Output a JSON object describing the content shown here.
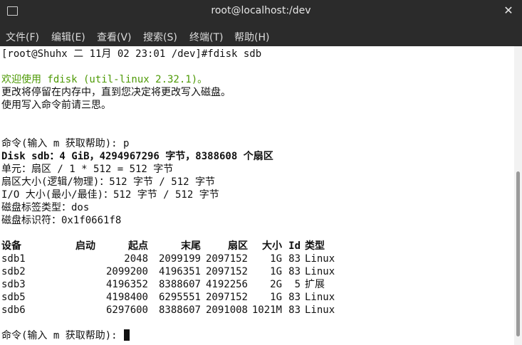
{
  "window": {
    "title": "root@localhost:/dev",
    "close_glyph": "✕",
    "icon_glyph": "⊡"
  },
  "menu": [
    "文件(F)",
    "编辑(E)",
    "查看(V)",
    "搜索(S)",
    "终端(T)",
    "帮助(H)"
  ],
  "terminal": {
    "prompt_line": "[root@Shuhx 二 11月 02 23:01 /dev]#fdisk sdb",
    "welcome": "欢迎使用 fdisk (util-linux 2.32.1)。",
    "notice1": "更改将停留在内存中，直到您决定将更改写入磁盘。",
    "notice2": "使用写入命令前请三思。",
    "cmd_p": "命令(输入 m 获取帮助): p",
    "disk_info": "Disk sdb：4 GiB，4294967296 字节，8388608 个扇区",
    "units": "单元：扇区 / 1 * 512 = 512 字节",
    "sector_size": "扇区大小(逻辑/物理)：512 字节 / 512 字节",
    "io_size": "I/O 大小(最小/最佳)：512 字节 / 512 字节",
    "label_type": "磁盘标签类型：dos",
    "identifier": "磁盘标识符：0x1f0661f8",
    "final_prompt": "命令(输入 m 获取帮助): "
  },
  "partition_table": {
    "headers": [
      "设备",
      "启动",
      "起点",
      "末尾",
      "扇区",
      "大小",
      "Id",
      "类型"
    ],
    "rows": [
      [
        "sdb1",
        "",
        "2048",
        "2099199",
        "2097152",
        "1G",
        "83",
        "Linux"
      ],
      [
        "sdb2",
        "",
        "2099200",
        "4196351",
        "2097152",
        "1G",
        "83",
        "Linux"
      ],
      [
        "sdb3",
        "",
        "4196352",
        "8388607",
        "4192256",
        "2G",
        "5",
        "扩展"
      ],
      [
        "sdb5",
        "",
        "4198400",
        "6295551",
        "2097152",
        "1G",
        "83",
        "Linux"
      ],
      [
        "sdb6",
        "",
        "6297600",
        "8388607",
        "2091008",
        "1021M",
        "83",
        "Linux"
      ]
    ]
  },
  "colors": {
    "titlebar_bg": "#2b2b2b",
    "terminal_bg": "#ffffff",
    "terminal_fg": "#111111",
    "welcome_green": "#4e9a06"
  }
}
